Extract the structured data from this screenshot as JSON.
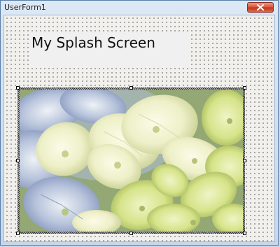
{
  "window": {
    "title": "UserForm1"
  },
  "form": {
    "label_text": "My Splash Screen"
  },
  "image": {
    "subject": "hydrangea-flowers"
  },
  "colors": {
    "form_background": "#f1f0ec",
    "title_gradient_top": "#dde8f5",
    "close_button": "#c23319"
  }
}
